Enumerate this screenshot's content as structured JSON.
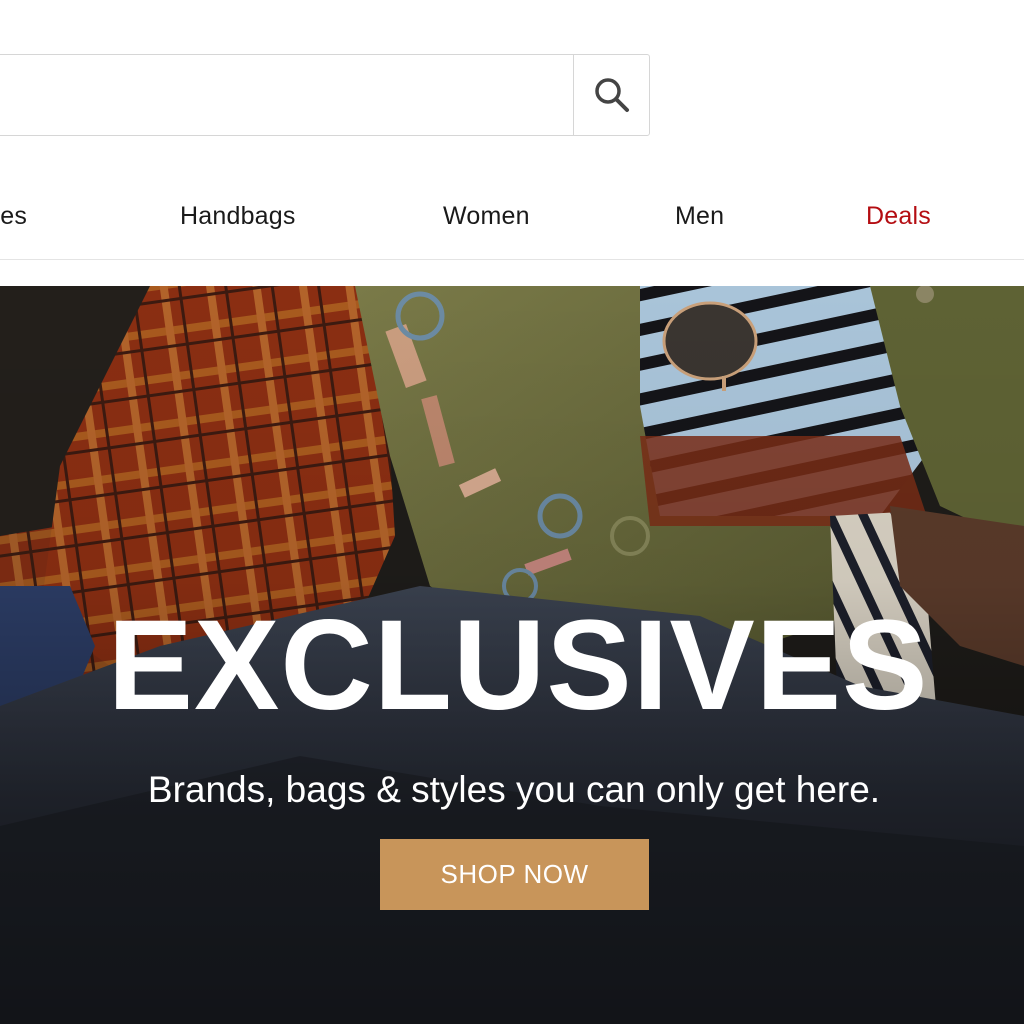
{
  "search": {
    "value": "",
    "placeholder": "",
    "button_icon": "search-icon"
  },
  "nav": {
    "items": [
      {
        "label": "ries"
      },
      {
        "label": "Handbags"
      },
      {
        "label": "Women"
      },
      {
        "label": "Men"
      },
      {
        "label": "Deals"
      }
    ],
    "deals_color": "#b40d12"
  },
  "hero": {
    "headline": "EXCLUSIVES",
    "subline": "Brands, bags & styles you can only get here.",
    "cta_label": "SHOP NOW",
    "cta_color": "#c8955a"
  }
}
